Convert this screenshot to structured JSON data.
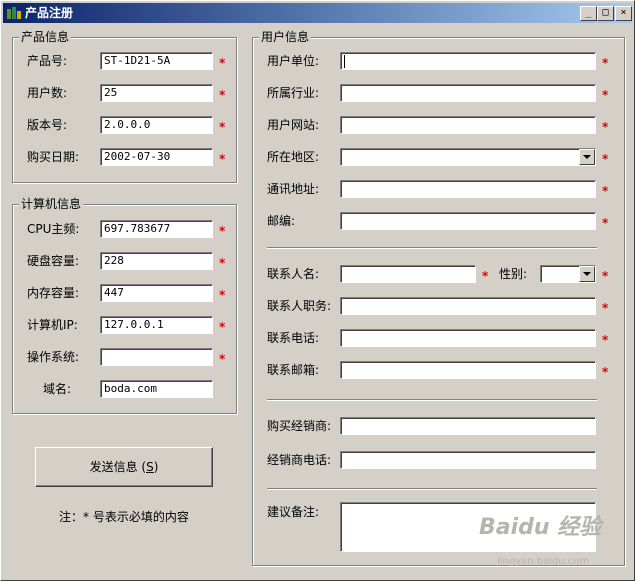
{
  "window": {
    "title": "产品注册",
    "min_label": "_",
    "max_label": "□",
    "close_label": "×"
  },
  "product": {
    "legend": "产品信息",
    "fields": [
      {
        "label": "产品号:",
        "value": "ST-1D21-5A"
      },
      {
        "label": "用户数:",
        "value": "25"
      },
      {
        "label": "版本号:",
        "value": "2.0.0.0"
      },
      {
        "label": "购买日期:",
        "value": "2002-07-30"
      }
    ]
  },
  "computer": {
    "legend": "计算机信息",
    "fields": [
      {
        "label": "CPU主频:",
        "value": "697.783677"
      },
      {
        "label": "硬盘容量:",
        "value": "228"
      },
      {
        "label": "内存容量:",
        "value": "447"
      },
      {
        "label": "计算机IP:",
        "value": "127.0.0.1"
      },
      {
        "label": "操作系统:",
        "value": ""
      },
      {
        "label": "域名:",
        "value": "boda.com"
      }
    ]
  },
  "user": {
    "legend": "用户信息",
    "unit_label": "用户单位:",
    "industry_label": "所属行业:",
    "website_label": "用户网站:",
    "region_label": "所在地区:",
    "address_label": "通讯地址:",
    "postcode_label": "邮编:",
    "contact_name_label": "联系人名:",
    "gender_label": "性别:",
    "contact_title_label": "联系人职务:",
    "contact_phone_label": "联系电话:",
    "contact_email_label": "联系邮箱:",
    "dealer_label": "购买经销商:",
    "dealer_phone_label": "经销商电话:",
    "remark_label": "建议备注:"
  },
  "required_mark": "*",
  "send_button": {
    "label": "发送信息",
    "accel": "S"
  },
  "note": "注：* 号表示必填的内容",
  "watermark": {
    "brand": "Baidu 经验",
    "url": "jingyan.baidu.com"
  }
}
